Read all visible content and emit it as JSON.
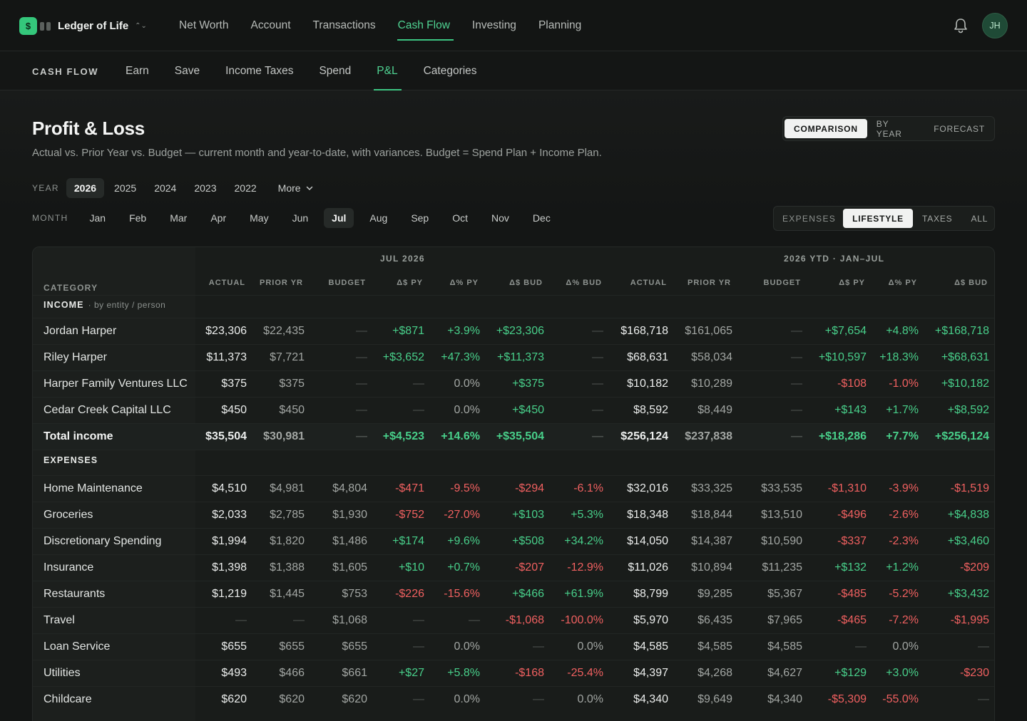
{
  "brand": {
    "logo": "$",
    "name": "Ledger of Life"
  },
  "nav": [
    "Net Worth",
    "Account",
    "Transactions",
    "Cash Flow",
    "Investing",
    "Planning"
  ],
  "nav_active": 3,
  "user": {
    "initials": "JH"
  },
  "subnav": {
    "title": "CASH FLOW",
    "items": [
      "Earn",
      "Save",
      "Income Taxes",
      "Spend",
      "P&L",
      "Categories"
    ],
    "active": 4
  },
  "page": {
    "title": "Profit & Loss",
    "subtitle": "Actual vs. Prior Year vs. Budget — current month and year-to-date, with variances. Budget = Spend Plan + Income Plan."
  },
  "view_toggle": {
    "options": [
      "COMPARISON",
      "BY YEAR",
      "FORECAST"
    ],
    "active": 0
  },
  "year_filter": {
    "label": "YEAR",
    "options": [
      "2026",
      "2025",
      "2024",
      "2023",
      "2022"
    ],
    "active": 0,
    "more": "More"
  },
  "month_filter": {
    "label": "MONTH",
    "options": [
      "Jan",
      "Feb",
      "Mar",
      "Apr",
      "May",
      "Jun",
      "Jul",
      "Aug",
      "Sep",
      "Oct",
      "Nov",
      "Dec"
    ],
    "active": 6
  },
  "expense_filter": {
    "label": "EXPENSES",
    "options": [
      "LIFESTYLE",
      "TAXES",
      "ALL"
    ],
    "active": 0
  },
  "table": {
    "group_month": "JUL 2026",
    "group_ytd": "2026 YTD · JAN–JUL",
    "category_header": "CATEGORY",
    "columns": [
      "ACTUAL",
      "PRIOR YR",
      "BUDGET",
      "Δ$ PY",
      "Δ% PY",
      "Δ$ BUD",
      "Δ% BUD",
      "ACTUAL",
      "PRIOR YR",
      "BUDGET",
      "Δ$ PY",
      "Δ% PY",
      "Δ$ BUD"
    ],
    "income_label": "INCOME",
    "income_sub": "· by entity / person",
    "expenses_label": "EXPENSES",
    "income_rows": [
      {
        "name": "Jordan Harper",
        "cells": [
          "$23,306",
          "$22,435",
          "—",
          "+$871",
          "+3.9%",
          "+$23,306",
          "—",
          "$168,718",
          "$161,065",
          "—",
          "+$7,654",
          "+4.8%",
          "+$168,718"
        ]
      },
      {
        "name": "Riley Harper",
        "cells": [
          "$11,373",
          "$7,721",
          "—",
          "+$3,652",
          "+47.3%",
          "+$11,373",
          "—",
          "$68,631",
          "$58,034",
          "—",
          "+$10,597",
          "+18.3%",
          "+$68,631"
        ]
      },
      {
        "name": "Harper Family Ventures LLC",
        "cells": [
          "$375",
          "$375",
          "—",
          "—",
          "0.0%",
          "+$375",
          "—",
          "$10,182",
          "$10,289",
          "—",
          "-$108",
          "-1.0%",
          "+$10,182"
        ]
      },
      {
        "name": "Cedar Creek Capital LLC",
        "cells": [
          "$450",
          "$450",
          "—",
          "—",
          "0.0%",
          "+$450",
          "—",
          "$8,592",
          "$8,449",
          "—",
          "+$143",
          "+1.7%",
          "+$8,592"
        ]
      }
    ],
    "total_income": {
      "name": "Total income",
      "cells": [
        "$35,504",
        "$30,981",
        "—",
        "+$4,523",
        "+14.6%",
        "+$35,504",
        "—",
        "$256,124",
        "$237,838",
        "—",
        "+$18,286",
        "+7.7%",
        "+$256,124"
      ]
    },
    "expense_rows": [
      {
        "name": "Home Maintenance",
        "cells": [
          "$4,510",
          "$4,981",
          "$4,804",
          "-$471",
          "-9.5%",
          "-$294",
          "-6.1%",
          "$32,016",
          "$33,325",
          "$33,535",
          "-$1,310",
          "-3.9%",
          "-$1,519"
        ]
      },
      {
        "name": "Groceries",
        "cells": [
          "$2,033",
          "$2,785",
          "$1,930",
          "-$752",
          "-27.0%",
          "+$103",
          "+5.3%",
          "$18,348",
          "$18,844",
          "$13,510",
          "-$496",
          "-2.6%",
          "+$4,838"
        ]
      },
      {
        "name": "Discretionary Spending",
        "cells": [
          "$1,994",
          "$1,820",
          "$1,486",
          "+$174",
          "+9.6%",
          "+$508",
          "+34.2%",
          "$14,050",
          "$14,387",
          "$10,590",
          "-$337",
          "-2.3%",
          "+$3,460"
        ]
      },
      {
        "name": "Insurance",
        "cells": [
          "$1,398",
          "$1,388",
          "$1,605",
          "+$10",
          "+0.7%",
          "-$207",
          "-12.9%",
          "$11,026",
          "$10,894",
          "$11,235",
          "+$132",
          "+1.2%",
          "-$209"
        ]
      },
      {
        "name": "Restaurants",
        "cells": [
          "$1,219",
          "$1,445",
          "$753",
          "-$226",
          "-15.6%",
          "+$466",
          "+61.9%",
          "$8,799",
          "$9,285",
          "$5,367",
          "-$485",
          "-5.2%",
          "+$3,432"
        ]
      },
      {
        "name": "Travel",
        "cells": [
          "—",
          "—",
          "$1,068",
          "—",
          "—",
          "-$1,068",
          "-100.0%",
          "$5,970",
          "$6,435",
          "$7,965",
          "-$465",
          "-7.2%",
          "-$1,995"
        ]
      },
      {
        "name": "Loan Service",
        "cells": [
          "$655",
          "$655",
          "$655",
          "—",
          "0.0%",
          "—",
          "0.0%",
          "$4,585",
          "$4,585",
          "$4,585",
          "—",
          "0.0%",
          "—"
        ]
      },
      {
        "name": "Utilities",
        "cells": [
          "$493",
          "$466",
          "$661",
          "+$27",
          "+5.8%",
          "-$168",
          "-25.4%",
          "$4,397",
          "$4,268",
          "$4,627",
          "+$129",
          "+3.0%",
          "-$230"
        ]
      },
      {
        "name": "Childcare",
        "cells": [
          "$620",
          "$620",
          "$620",
          "—",
          "0.0%",
          "—",
          "0.0%",
          "$4,340",
          "$9,649",
          "$4,340",
          "-$5,309",
          "-55.0%",
          "—"
        ]
      }
    ]
  }
}
